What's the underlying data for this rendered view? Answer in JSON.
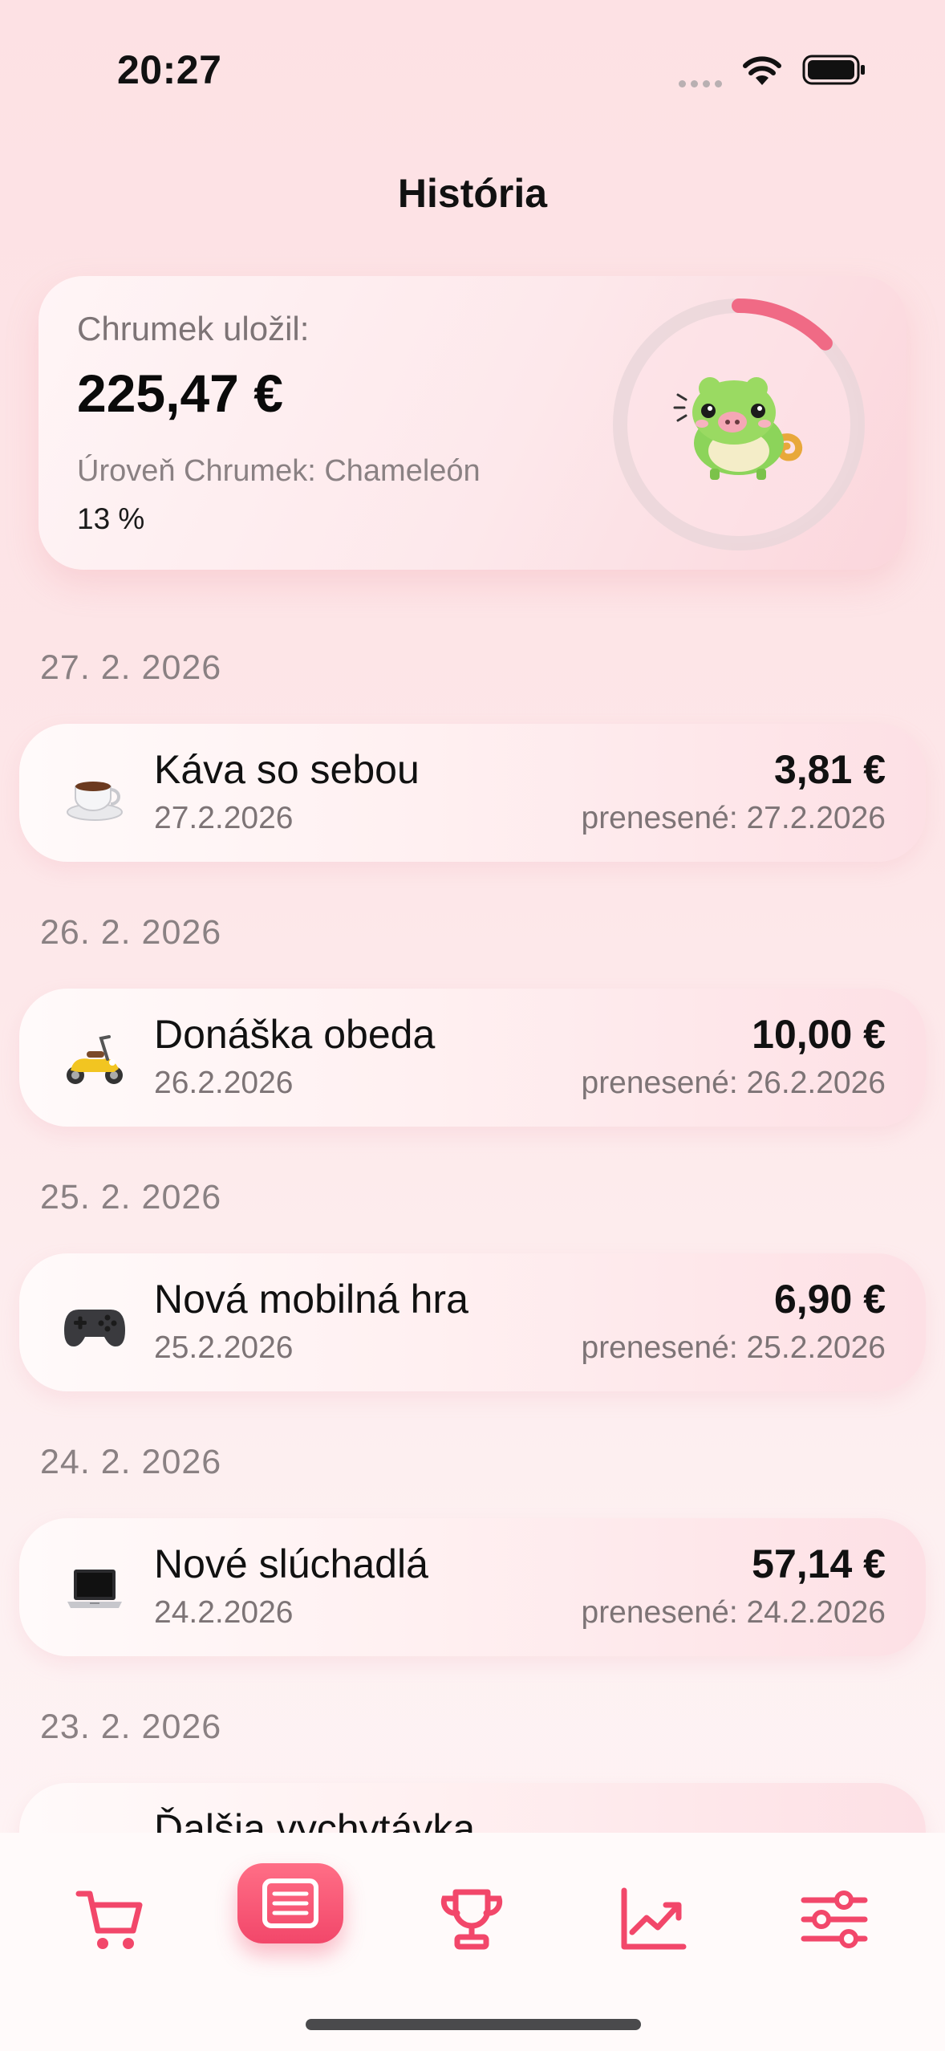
{
  "status_bar": {
    "time": "20:27"
  },
  "page": {
    "title": "História"
  },
  "summary": {
    "saved_label": "Chrumek uložil:",
    "saved_amount": "225,47 €",
    "level_label": "Úroveň Chrumek: Chameleón",
    "level_percent": "13 %",
    "progress": 0.13,
    "accent_color": "#f06a85"
  },
  "days": [
    {
      "date": "27. 2. 2026",
      "item": {
        "icon": "coffee-icon",
        "title": "Káva so sebou",
        "date": "27.2.2026",
        "amount": "3,81 €",
        "carried": "prenesené: 27.2.2026"
      }
    },
    {
      "date": "26. 2. 2026",
      "item": {
        "icon": "scooter-icon",
        "title": "Donáška obeda",
        "date": "26.2.2026",
        "amount": "10,00 €",
        "carried": "prenesené: 26.2.2026"
      }
    },
    {
      "date": "25. 2. 2026",
      "item": {
        "icon": "gamepad-icon",
        "title": "Nová mobilná hra",
        "date": "25.2.2026",
        "amount": "6,90 €",
        "carried": "prenesené: 25.2.2026"
      }
    },
    {
      "date": "24. 2. 2026",
      "item": {
        "icon": "laptop-icon",
        "title": "Nové slúchadlá",
        "date": "24.2.2026",
        "amount": "57,14 €",
        "carried": "prenesené: 24.2.2026"
      }
    },
    {
      "date": "23. 2. 2026",
      "item": {
        "title": "Ďalšia vychytávka"
      }
    }
  ],
  "tab_bar": {
    "tabs": [
      "cart-icon",
      "list-icon",
      "trophy-icon",
      "chart-icon",
      "sliders-icon"
    ],
    "active": "list-icon",
    "accent": "#f2476a"
  }
}
